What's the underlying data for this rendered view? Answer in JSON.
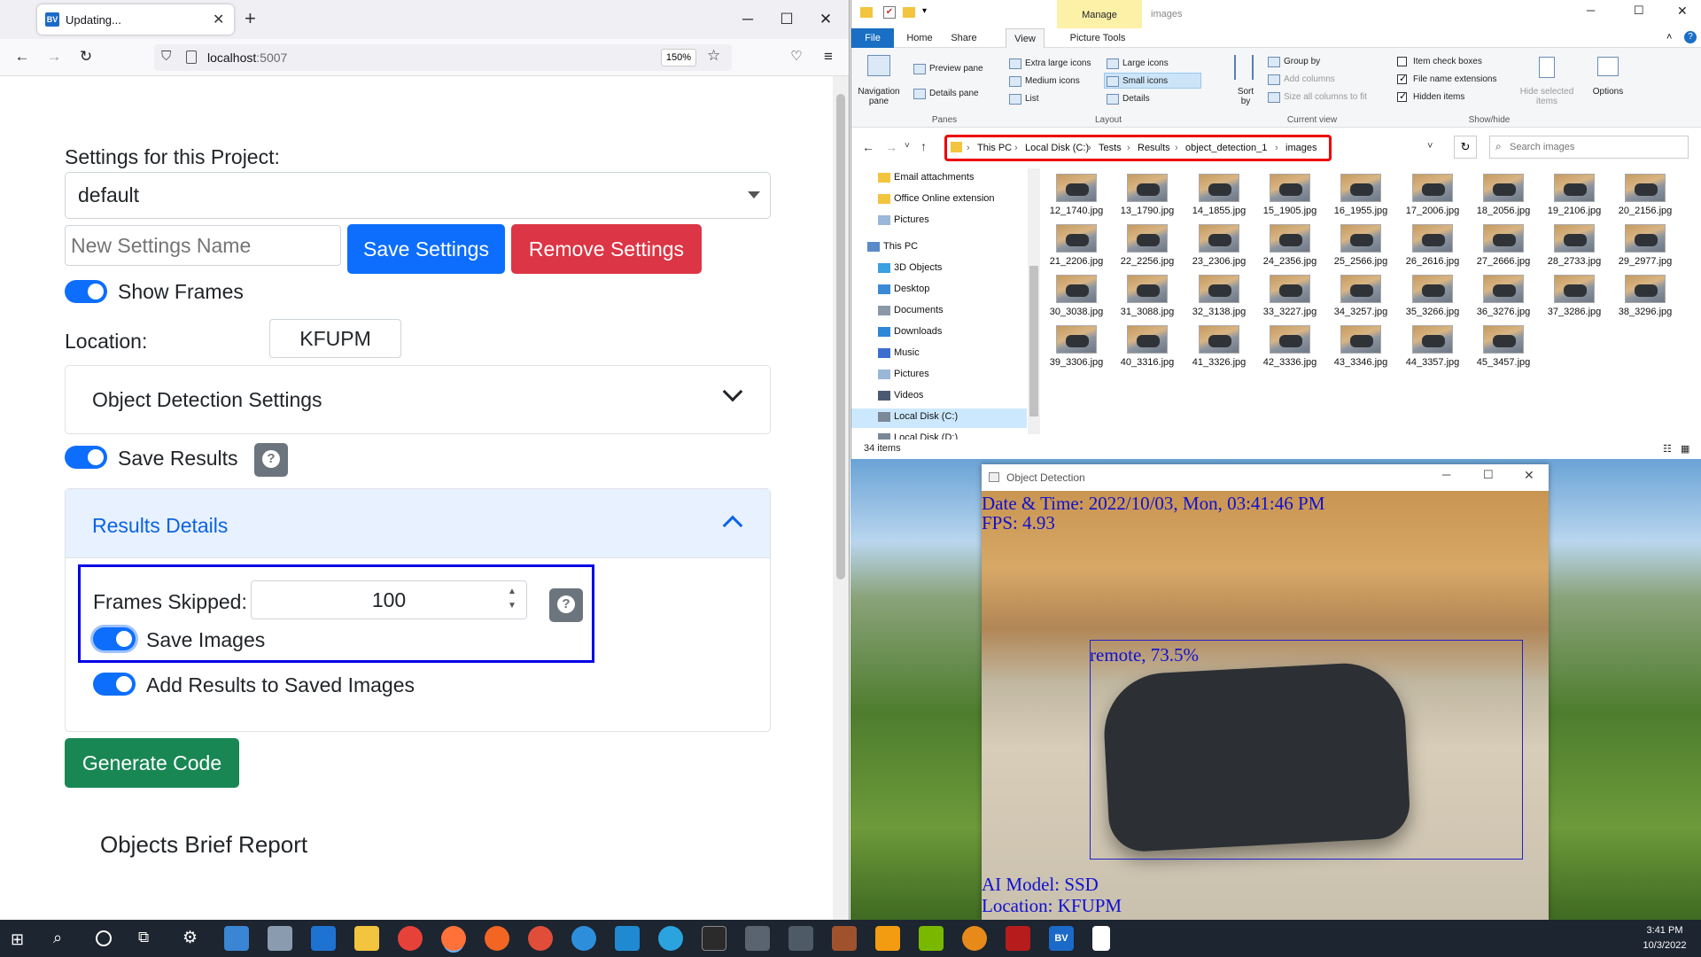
{
  "browser": {
    "tab_title": "Updating...",
    "tab_favicon": "BV",
    "url_host": "localhost",
    "url_port": ":5007",
    "zoom": "150%"
  },
  "app": {
    "settings_label": "Settings for this Project:",
    "settings_selected": "default",
    "new_settings_placeholder": "New Settings Name",
    "save_settings": "Save Settings",
    "remove_settings": "Remove Settings",
    "show_frames": "Show Frames",
    "location_label": "Location:",
    "location_value": "KFUPM",
    "object_detection_settings": "Object Detection Settings",
    "save_results": "Save Results",
    "results_details": "Results Details",
    "frames_skipped_label": "Frames Skipped:",
    "frames_skipped_value": "100",
    "save_images": "Save Images",
    "add_results": "Add Results to Saved Images",
    "generate_code": "Generate Code",
    "objects_brief_report": "Objects Brief Report"
  },
  "explorer": {
    "title": "images",
    "manage_tab": "Manage",
    "tabs": [
      "File",
      "Home",
      "Share",
      "View",
      "Picture Tools"
    ],
    "ribbon": {
      "navigation_pane": "Navigation pane",
      "preview_pane": "Preview pane",
      "details_pane": "Details pane",
      "panes_group": "Panes",
      "layout_items": [
        "Extra large icons",
        "Large icons",
        "Medium icons",
        "Small icons",
        "List",
        "Details"
      ],
      "layout_group": "Layout",
      "sort_by": "Sort by",
      "group_by": "Group by",
      "add_columns": "Add columns",
      "size_columns": "Size all columns to fit",
      "current_view_group": "Current view",
      "item_check_boxes": "Item check boxes",
      "file_name_extensions": "File name extensions",
      "hidden_items": "Hidden items",
      "hide_selected": "Hide selected items",
      "show_hide_group": "Show/hide",
      "options": "Options"
    },
    "breadcrumb": [
      "This PC",
      "Local Disk (C:)",
      "Tests",
      "Results",
      "object_detection_1",
      "images"
    ],
    "search_placeholder": "Search images",
    "nav_items": [
      "Email attachments",
      "Office Online extension",
      "Pictures",
      "This PC",
      "3D Objects",
      "Desktop",
      "Documents",
      "Downloads",
      "Music",
      "Pictures",
      "Videos",
      "Local Disk (C:)",
      "Local Disk (D:)"
    ],
    "files": [
      "12_1740.jpg",
      "13_1790.jpg",
      "14_1855.jpg",
      "15_1905.jpg",
      "16_1955.jpg",
      "17_2006.jpg",
      "18_2056.jpg",
      "19_2106.jpg",
      "20_2156.jpg",
      "21_2206.jpg",
      "22_2256.jpg",
      "23_2306.jpg",
      "24_2356.jpg",
      "25_2566.jpg",
      "26_2616.jpg",
      "27_2666.jpg",
      "28_2733.jpg",
      "29_2977.jpg",
      "30_3038.jpg",
      "31_3088.jpg",
      "32_3138.jpg",
      "33_3227.jpg",
      "34_3257.jpg",
      "35_3266.jpg",
      "36_3276.jpg",
      "37_3286.jpg",
      "38_3296.jpg",
      "39_3306.jpg",
      "40_3316.jpg",
      "41_3326.jpg",
      "42_3336.jpg",
      "43_3346.jpg",
      "44_3357.jpg",
      "45_3457.jpg"
    ],
    "status": "34 items"
  },
  "detection": {
    "window_title": "Object Detection",
    "datetime": "Date & Time: 2022/10/03, Mon, 03:41:46 PM",
    "fps": "FPS: 4.93",
    "label": "remote, 73.5%",
    "model": "AI Model: SSD",
    "location": "Location: KFUPM"
  },
  "taskbar": {
    "time": "3:41 PM",
    "date": "10/3/2022",
    "bv_label": "BV"
  }
}
